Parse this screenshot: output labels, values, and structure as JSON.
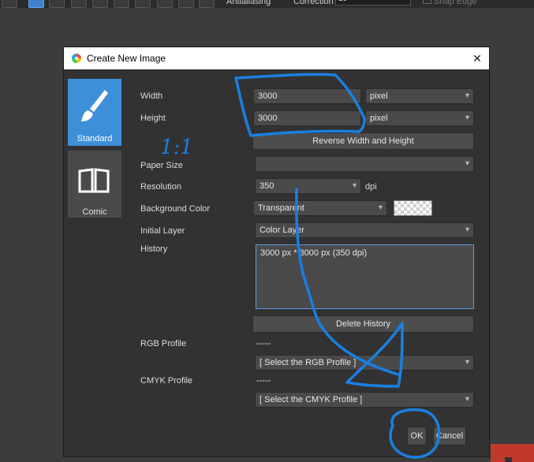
{
  "toolbar": {
    "antialiasing_label": "Antialiasing",
    "correction_label": "Correction",
    "correction_value": "10",
    "snap_label": "Snap Edge"
  },
  "dialog": {
    "title": "Create New Image",
    "close_label": "✕",
    "sidebar": {
      "standard_label": "Standard",
      "comic_label": "Comic"
    },
    "width_label": "Width",
    "width_value": "3000",
    "width_unit": "pixel",
    "height_label": "Height",
    "height_value": "3000",
    "height_unit": "pixel",
    "reverse_button": "Reverse Width and Height",
    "paper_size_label": "Paper Size",
    "paper_size_value": "",
    "resolution_label": "Resolution",
    "resolution_value": "350",
    "resolution_unit": "dpi",
    "bg_color_label": "Background Color",
    "bg_color_value": "Transparent",
    "initial_layer_label": "Initial Layer",
    "initial_layer_value": "Color Layer",
    "history_label": "History",
    "history_value": "3000 px * 3000 px (350 dpi)",
    "delete_history_button": "Delete History",
    "rgb_profile_label": "RGB Profile",
    "rgb_profile_dash": "-----",
    "rgb_profile_value": "[ Select the RGB Profile ]",
    "cmyk_profile_label": "CMYK Profile",
    "cmyk_profile_dash": "-----",
    "cmyk_profile_value": "[ Select the CMYK Profile ]",
    "ok_button": "OK",
    "cancel_button": "Cancel"
  },
  "annotation": {
    "handwritten_text": "1:1",
    "color": "#1a7fe0"
  }
}
